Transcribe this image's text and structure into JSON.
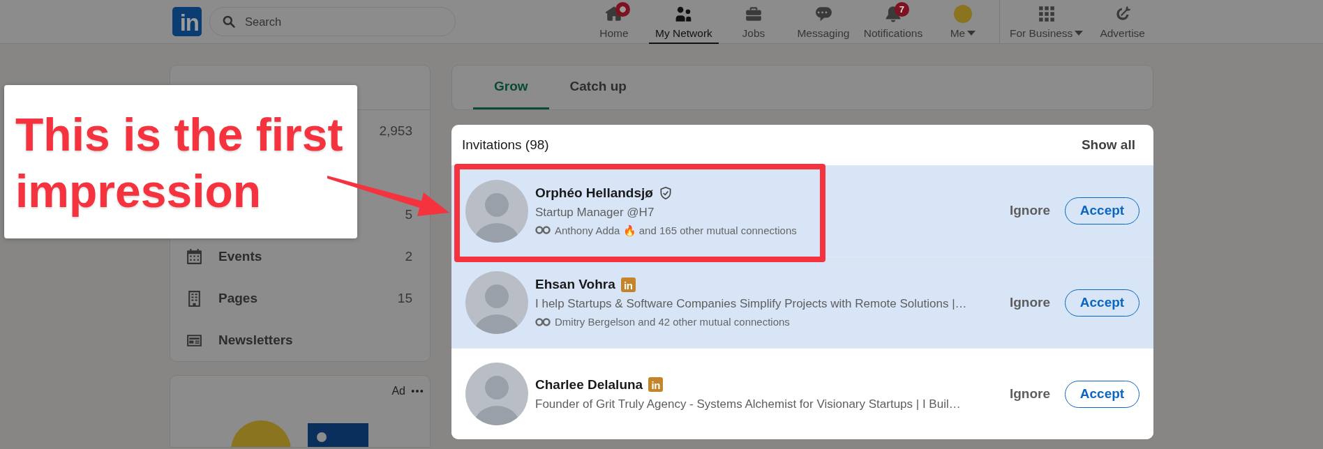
{
  "nav": {
    "logo": {
      "text": "in"
    },
    "search": {
      "placeholder": "Search"
    },
    "items": [
      {
        "label": "Home",
        "selected": false,
        "dot": true,
        "dropdown": false
      },
      {
        "label": "My Network",
        "selected": true,
        "dot": false,
        "dropdown": false
      },
      {
        "label": "Jobs",
        "selected": false,
        "dot": false,
        "dropdown": false
      },
      {
        "label": "Messaging",
        "selected": false,
        "dot": false,
        "dropdown": false
      },
      {
        "label": "Notifications",
        "selected": false,
        "dot": false,
        "badge": "7",
        "dropdown": false
      },
      {
        "label": "Me",
        "selected": false,
        "dot": false,
        "dropdown": true
      }
    ],
    "business_items": [
      {
        "label": "For Business",
        "dropdown": true
      },
      {
        "label": "Advertise",
        "dropdown": false
      }
    ]
  },
  "sidebar": {
    "items": [
      {
        "count": "2,953"
      },
      {
        "count": "5"
      },
      {
        "label": "Events",
        "count": "2"
      },
      {
        "label": "Pages",
        "count": "15"
      },
      {
        "label": "Newsletters"
      }
    ]
  },
  "ad": {
    "label": "Ad"
  },
  "tabs": [
    {
      "label": "Grow",
      "selected": true
    },
    {
      "label": "Catch up",
      "selected": false
    }
  ],
  "invitations": {
    "title": "Invitations (98)",
    "show_all": "Show all",
    "rows": [
      {
        "name": "Orphéo Hellandsjø",
        "badge": {
          "kind": "verified"
        },
        "headline": "Startup Manager @H7",
        "mutual": "Anthony Adda 🔥 and 165 other mutual connections",
        "unread": true,
        "ignore": "Ignore",
        "accept": "Accept"
      },
      {
        "name": "Ehsan Vohra",
        "badge": {
          "kind": "premium",
          "text": "in"
        },
        "headline": "I help Startups & Software Companies Simplify Projects with Remote Solutions |…",
        "mutual": "Dmitry Bergelson and 42 other mutual connections",
        "unread": true,
        "ignore": "Ignore",
        "accept": "Accept"
      },
      {
        "name": "Charlee Delaluna",
        "badge": {
          "kind": "premium",
          "text": "in"
        },
        "headline": "Founder of Grit Truly Agency - Systems Alchemist for Visionary Startups | I Buil…",
        "unread": false,
        "ignore": "Ignore",
        "accept": "Accept"
      }
    ]
  },
  "annotation": {
    "text": "This is the first impression"
  }
}
